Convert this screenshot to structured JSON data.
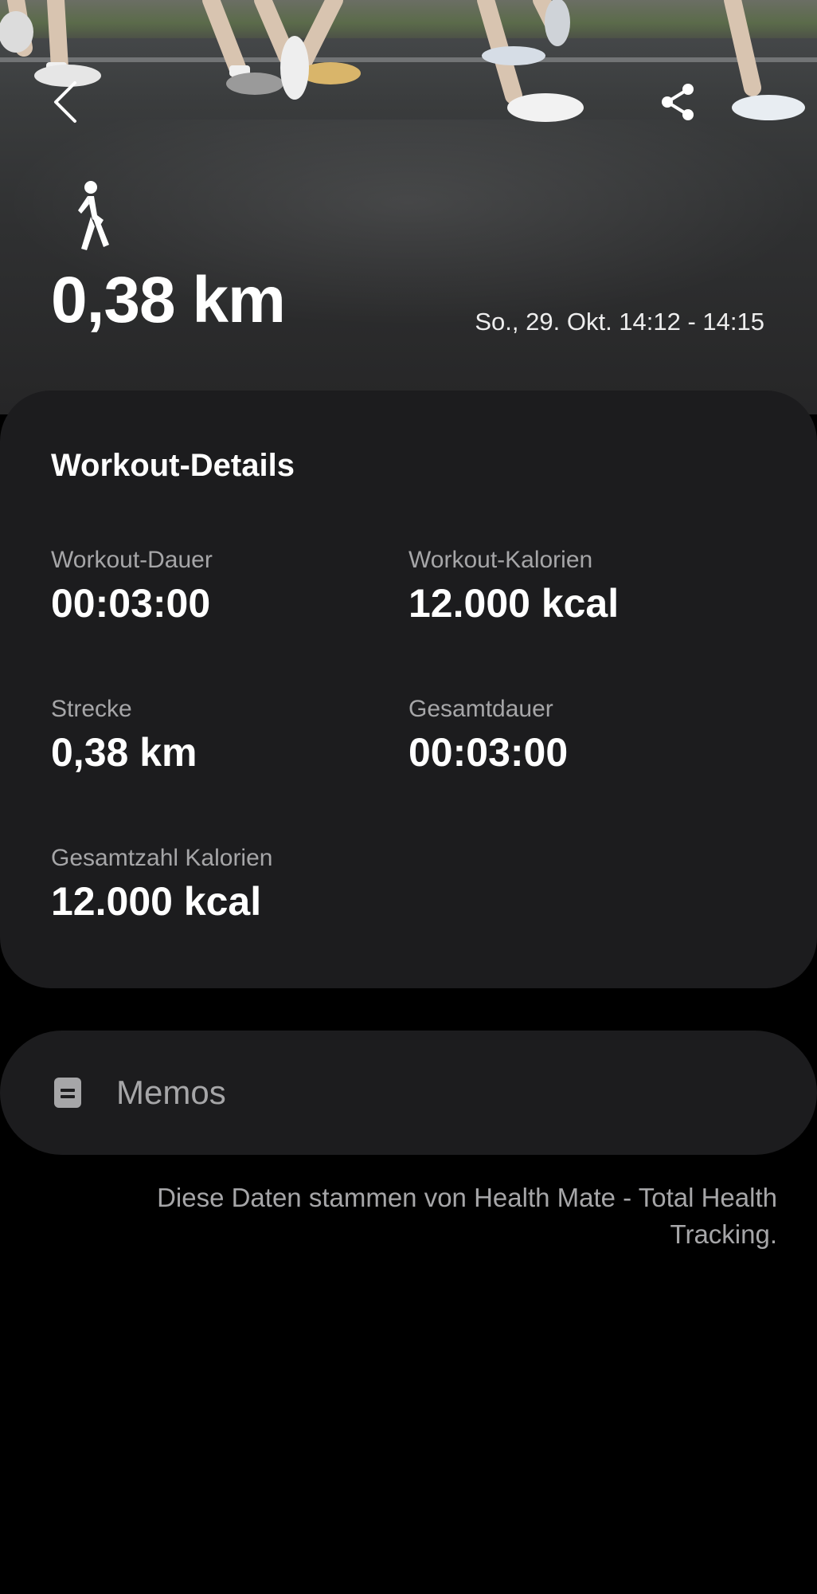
{
  "hero": {
    "back_icon": "chevron-left-icon",
    "share_icon": "share-icon",
    "activity_icon": "walking-person-icon",
    "distance": "0,38 km",
    "date_range": "So., 29. Okt. 14:12 - 14:15"
  },
  "details": {
    "title": "Workout-Details",
    "metrics": [
      {
        "label": "Workout-Dauer",
        "value": "00:03:00"
      },
      {
        "label": "Workout-Kalorien",
        "value": "12.000 kcal"
      },
      {
        "label": "Strecke",
        "value": "0,38 km"
      },
      {
        "label": "Gesamtdauer",
        "value": "00:03:00"
      },
      {
        "label": "Gesamtzahl Kalorien",
        "value": "12.000 kcal"
      }
    ]
  },
  "memos": {
    "icon": "note-icon",
    "label": "Memos"
  },
  "source_note": "Diese Daten stammen von Health Mate - Total Health Tracking.",
  "colors": {
    "background": "#000000",
    "card": "#1c1c1e",
    "secondary_text": "#a6a6a8",
    "primary_text": "#ffffff"
  }
}
